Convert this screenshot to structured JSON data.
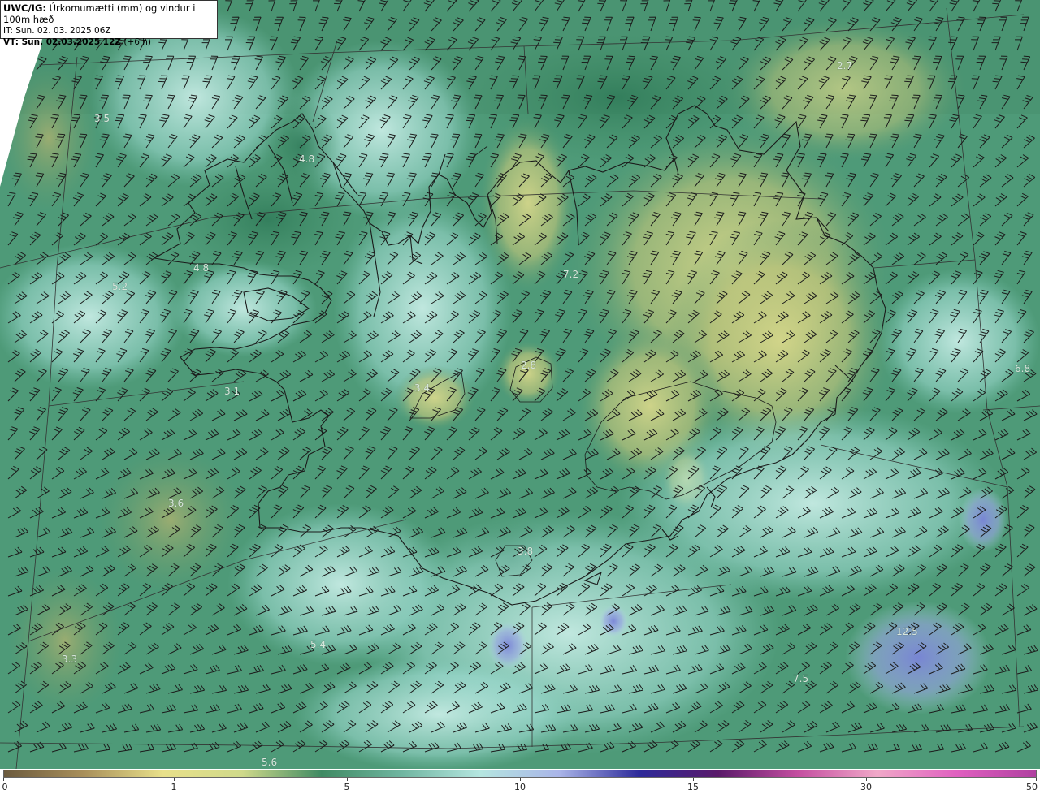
{
  "header": {
    "title_prefix": "UWC/IG:",
    "title_text": " Úrkomumætti (mm) og vindur i 100m hæð",
    "init_time": "IT: Sun. 02. 03. 2025 06Z",
    "valid_prefix": "VT: Sun. 02.03.2025 12Z",
    "valid_suffix": " (+6 h)"
  },
  "map_labels": [
    {
      "id": "label-west-3-5",
      "text": "3.5"
    },
    {
      "id": "label-westfjords-4-8-north",
      "text": "4.8"
    },
    {
      "id": "label-westfjords-4-8-south",
      "text": "4.8"
    },
    {
      "id": "label-west-5-2",
      "text": "5.2"
    },
    {
      "id": "label-northeast-2-7",
      "text": "2.7"
    },
    {
      "id": "label-north-7-2",
      "text": "7.2"
    },
    {
      "id": "label-central-2-8",
      "text": "2.8"
    },
    {
      "id": "label-central-3-4",
      "text": "3.4"
    },
    {
      "id": "label-snaefellsnes-3-1",
      "text": "3.1"
    },
    {
      "id": "label-east-6-8",
      "text": "6.8"
    },
    {
      "id": "label-southwest-3-6",
      "text": "3.6"
    },
    {
      "id": "label-south-3-8",
      "text": "3.8"
    },
    {
      "id": "label-far-southwest-3-3",
      "text": "3.3"
    },
    {
      "id": "label-south-sea-5-4",
      "text": "5.4"
    },
    {
      "id": "label-southeast-sea-12-5",
      "text": "12.5"
    },
    {
      "id": "label-southeast-sea-7-5",
      "text": "7.5"
    },
    {
      "id": "label-bottom-5-6",
      "text": "5.6"
    }
  ],
  "legend": {
    "tick_labels": [
      "0",
      "1",
      "5",
      "10",
      "15",
      "30",
      "50"
    ],
    "colors": [
      "#6b5a3e",
      "#a88f5a",
      "#e8e08a",
      "#cfd98a",
      "#3f8a63",
      "#6fb5a0",
      "#b5e6e0",
      "#a9b4e8",
      "#2d2a9a",
      "#5a1a6a",
      "#c44ea0",
      "#f0a8c8",
      "#e060c0",
      "#b040a0"
    ]
  },
  "styles": {
    "land_high_color": "#c9c97a",
    "sea_color": "#5fa58a",
    "coast_color": "#1a1a1a",
    "barb_color": "#1e1e1e"
  }
}
